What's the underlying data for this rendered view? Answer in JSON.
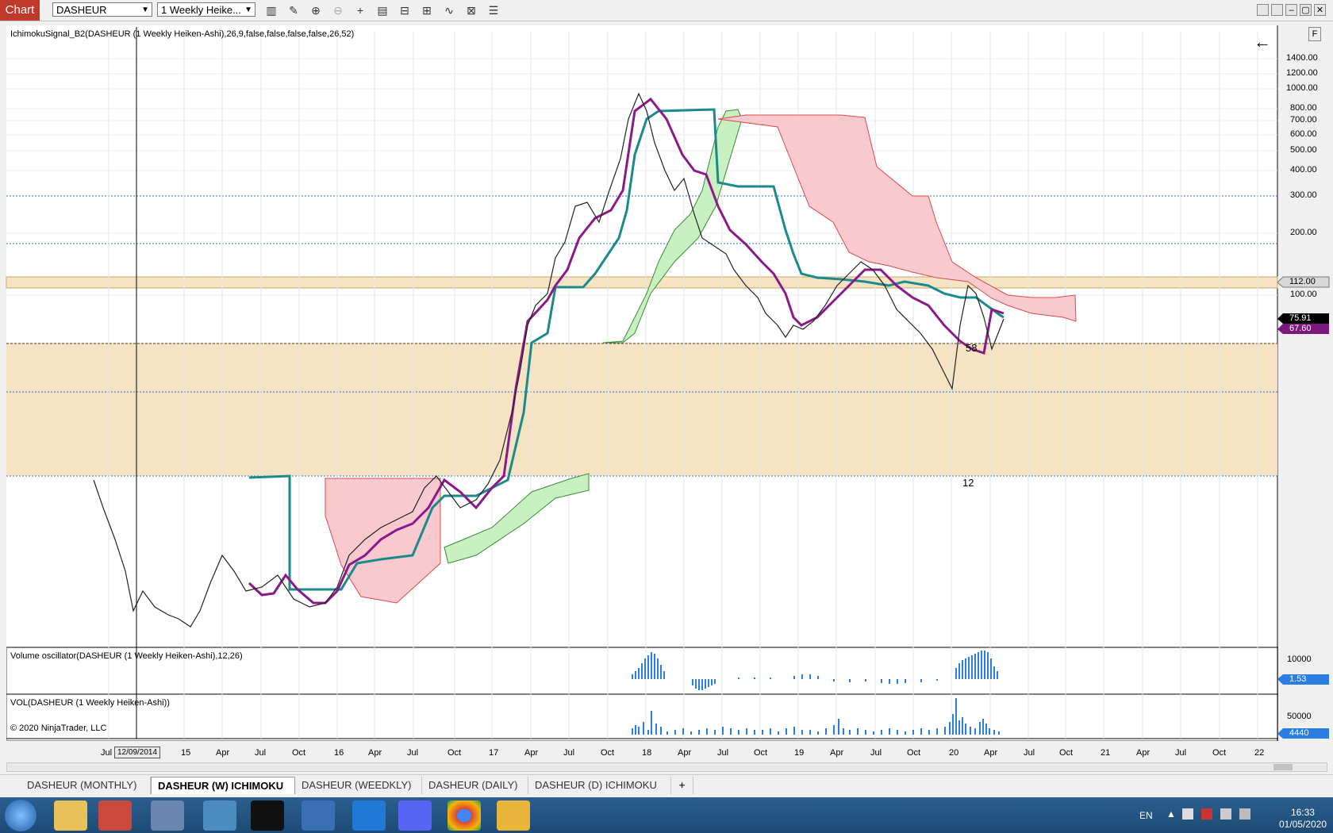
{
  "toolbar": {
    "chart_tab": "Chart",
    "instrument": "DASHEUR",
    "interval": "1 Weekly Heike...",
    "icons": [
      "bar-chart-icon",
      "pencil-icon",
      "zoom-in-icon",
      "zoom-out-icon",
      "crosshair-icon",
      "data-box-icon",
      "properties-icon",
      "templates-icon",
      "indicators-icon",
      "strategies-icon",
      "chart-trader-icon"
    ]
  },
  "window_buttons": [
    "tile-icon",
    "tile-icon",
    "minimize-icon",
    "restore-icon",
    "close-icon"
  ],
  "chart": {
    "price_panel_title": "IchimokuSignal_B2(DASHEUR (1 Weekly Heiken-Ashi),26,9,false,false,false,false,26,52)",
    "volosc_title": "Volume oscillator(DASHEUR (1 Weekly Heiken-Ashi),12,26)",
    "vol_title": "VOL(DASHEUR (1 Weekly Heiken-Ashi))",
    "copyright": "© 2020 NinjaTrader, LLC",
    "y_axis_labels": [
      "1400.00",
      "1200.00",
      "1000.00",
      "800.00",
      "700.00",
      "600.00",
      "500.00",
      "400.00",
      "300.00",
      "200.00",
      "100.00"
    ],
    "price_tags": {
      "level": "112.00",
      "last": "75.91",
      "kijun": "67.60"
    },
    "zone_labels": {
      "upper": "58",
      "lower": "12"
    },
    "volosc_axis": "10000",
    "volosc_tag": "1.53",
    "vol_axis": "50000",
    "vol_tag": "4440",
    "x_axis_labels": [
      "Jul",
      "15",
      "Apr",
      "Jul",
      "Oct",
      "16",
      "Apr",
      "Jul",
      "Oct",
      "17",
      "Apr",
      "Jul",
      "Oct",
      "18",
      "Apr",
      "Jul",
      "Oct",
      "19",
      "Apr",
      "Jul",
      "Oct",
      "20",
      "Apr",
      "Jul",
      "Oct",
      "21",
      "Apr",
      "Jul",
      "Oct",
      "22"
    ],
    "crosshair_date": "12/09/2014",
    "side_button": "F"
  },
  "tabs": [
    "DASHEUR (MONTHLY)",
    "DASHEUR (W) ICHIMOKU",
    "DASHEUR (WEEDKLY)",
    "DASHEUR (DAILY)",
    "DASHEUR (D) ICHIMOKU",
    "+"
  ],
  "taskbar": {
    "lang": "EN",
    "time": "16:33",
    "date": "01/05/2020"
  }
}
